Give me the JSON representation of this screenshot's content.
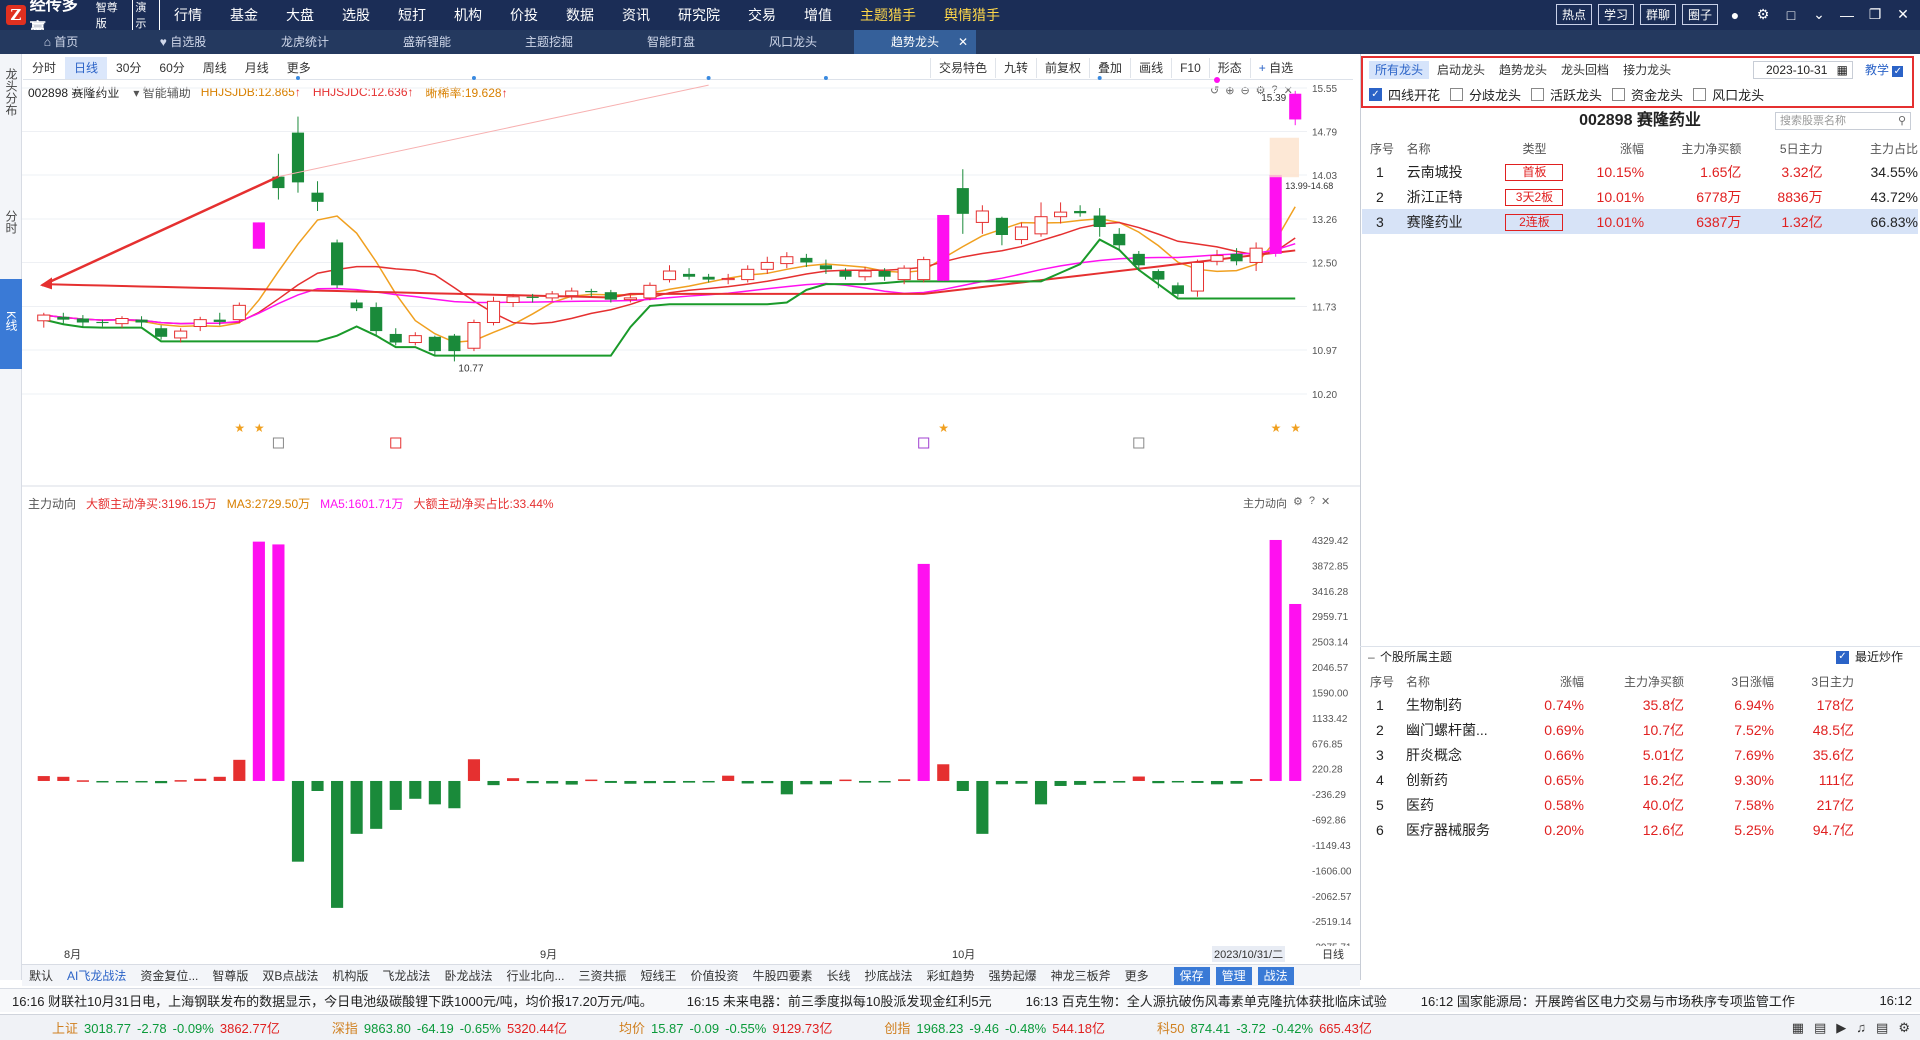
{
  "app": {
    "name": "经传多赢",
    "edition": "智尊版",
    "demo": "演示",
    "logo_letter": "Z"
  },
  "main_menu": [
    "行情",
    "基金",
    "大盘",
    "选股",
    "短打",
    "机构",
    "价投",
    "数据",
    "资讯",
    "研究院",
    "交易",
    "增值",
    "主题猎手",
    "舆情猎手"
  ],
  "top_right": {
    "buttons": [
      "热点",
      "学习",
      "群聊",
      "圈子"
    ],
    "icons": [
      "user-icon",
      "settings-icon",
      "window-icon",
      "chevron-down-icon",
      "minimize-icon",
      "restore-icon",
      "close-icon"
    ]
  },
  "tabs": [
    "首页",
    "自选股",
    "龙虎统计",
    "盛新锂能",
    "主题挖掘",
    "智能盯盘",
    "风口龙头",
    "趋势龙头"
  ],
  "left_rail": {
    "top": "龙头分布",
    "mid": "分时",
    "kline": "K线"
  },
  "periods": [
    "分时",
    "日线",
    "30分",
    "60分",
    "周线",
    "月线",
    "更多"
  ],
  "tools": [
    "交易特色",
    "九转",
    "前复权",
    "叠加",
    "画线",
    "F10",
    "形态",
    "自选"
  ],
  "stock": {
    "code_name": "002898 赛隆药业",
    "assist": "智能辅助",
    "ind1": "HHJSJDB:12.865",
    "ind2": "HHJSJDC:12.636",
    "ind3": "晰稀率:19.628",
    "price_high_label": "15.39",
    "range_label": "13.99-14.68",
    "low_label": "10.77",
    "y_ticks": [
      "15.55",
      "14.79",
      "14.03",
      "13.26",
      "12.50",
      "11.73",
      "10.97",
      "10.20"
    ]
  },
  "colors": {
    "up": "#e53030",
    "down": "#1a8a3a",
    "limit": "#ff10f0",
    "accent": "#2b63c7",
    "nav": "#1b2d56"
  },
  "sub_chart": {
    "title": "主力动向",
    "l1": "大额主动净买:3196.15万",
    "l2": "MA3:2729.50万",
    "l3": "MA5:1601.71万",
    "l4": "大额主动净买占比:33.44%",
    "unit": "X万",
    "y_ticks": [
      "4329.42",
      "3872.85",
      "3416.28",
      "2959.71",
      "2503.14",
      "2046.57",
      "1590.00",
      "1133.42",
      "676.85",
      "220.28",
      "-236.29",
      "-692.86",
      "-1149.43",
      "-1606.00",
      "-2062.57",
      "-2519.14",
      "-2975.71"
    ]
  },
  "chart_data": {
    "type": "candlestick",
    "title": "002898 赛隆药业",
    "ylim": [
      10.2,
      15.55
    ],
    "x_labels": [
      "8月",
      "9月",
      "10月",
      "2023/10/31/二"
    ],
    "candles": [
      [
        11.48,
        11.58,
        11.36,
        11.62,
        "u"
      ],
      [
        11.55,
        11.5,
        11.42,
        11.62,
        "d"
      ],
      [
        11.52,
        11.45,
        11.38,
        11.58,
        "d"
      ],
      [
        11.46,
        11.44,
        11.38,
        11.5,
        "d"
      ],
      [
        11.43,
        11.52,
        11.36,
        11.56,
        "u"
      ],
      [
        11.5,
        11.45,
        11.38,
        11.56,
        "d"
      ],
      [
        11.35,
        11.2,
        11.15,
        11.4,
        "d"
      ],
      [
        11.18,
        11.3,
        11.1,
        11.35,
        "u"
      ],
      [
        11.38,
        11.5,
        11.3,
        11.55,
        "u"
      ],
      [
        11.5,
        11.46,
        11.4,
        11.62,
        "d"
      ],
      [
        11.5,
        11.75,
        11.44,
        11.8,
        "u"
      ],
      [
        12.74,
        13.2,
        12.74,
        13.2,
        "l"
      ],
      [
        14.0,
        13.8,
        13.6,
        14.4,
        "d"
      ],
      [
        14.77,
        13.9,
        13.72,
        15.05,
        "d"
      ],
      [
        13.72,
        13.56,
        13.4,
        13.92,
        "d"
      ],
      [
        12.85,
        12.1,
        12.05,
        12.9,
        "d"
      ],
      [
        11.8,
        11.7,
        11.65,
        11.85,
        "d"
      ],
      [
        11.72,
        11.3,
        11.22,
        11.8,
        "d"
      ],
      [
        11.25,
        11.1,
        11.05,
        11.35,
        "d"
      ],
      [
        11.1,
        11.22,
        11.05,
        11.28,
        "u"
      ],
      [
        11.2,
        10.95,
        10.88,
        11.22,
        "d"
      ],
      [
        11.22,
        10.95,
        10.77,
        11.25,
        "d"
      ],
      [
        11.0,
        11.45,
        10.95,
        11.5,
        "u"
      ],
      [
        11.45,
        11.82,
        11.4,
        11.9,
        "u"
      ],
      [
        11.8,
        11.9,
        11.72,
        11.95,
        "u"
      ],
      [
        11.9,
        11.88,
        11.8,
        11.95,
        "d"
      ],
      [
        11.88,
        11.95,
        11.82,
        12.0,
        "u"
      ],
      [
        11.92,
        12.0,
        11.85,
        12.06,
        "u"
      ],
      [
        12.0,
        11.98,
        11.9,
        12.04,
        "d"
      ],
      [
        11.98,
        11.85,
        11.8,
        12.02,
        "d"
      ],
      [
        11.85,
        11.88,
        11.8,
        11.95,
        "u"
      ],
      [
        11.88,
        12.1,
        11.84,
        12.15,
        "u"
      ],
      [
        12.2,
        12.35,
        12.15,
        12.45,
        "u"
      ],
      [
        12.3,
        12.25,
        12.2,
        12.4,
        "d"
      ],
      [
        12.25,
        12.2,
        12.15,
        12.3,
        "d"
      ],
      [
        12.2,
        12.22,
        12.12,
        12.3,
        "u"
      ],
      [
        12.2,
        12.38,
        12.15,
        12.45,
        "u"
      ],
      [
        12.38,
        12.5,
        12.3,
        12.6,
        "u"
      ],
      [
        12.48,
        12.6,
        12.4,
        12.68,
        "u"
      ],
      [
        12.58,
        12.5,
        12.42,
        12.65,
        "d"
      ],
      [
        12.45,
        12.38,
        12.3,
        12.55,
        "d"
      ],
      [
        12.35,
        12.25,
        12.2,
        12.4,
        "d"
      ],
      [
        12.25,
        12.35,
        12.18,
        12.42,
        "u"
      ],
      [
        12.35,
        12.25,
        12.18,
        12.4,
        "d"
      ],
      [
        12.2,
        12.4,
        12.12,
        12.45,
        "u"
      ],
      [
        12.2,
        12.55,
        12.15,
        12.6,
        "u"
      ],
      [
        12.18,
        13.33,
        12.18,
        13.33,
        "l"
      ],
      [
        13.8,
        13.35,
        13.0,
        14.13,
        "d"
      ],
      [
        13.4,
        13.2,
        13.0,
        13.5,
        "u"
      ],
      [
        13.28,
        12.98,
        12.8,
        13.3,
        "d"
      ],
      [
        12.9,
        13.12,
        12.82,
        13.2,
        "u"
      ],
      [
        13.0,
        13.3,
        12.95,
        13.55,
        "u"
      ],
      [
        13.3,
        13.38,
        13.18,
        13.55,
        "u"
      ],
      [
        13.36,
        13.4,
        13.3,
        13.5,
        "d"
      ],
      [
        13.32,
        13.12,
        12.95,
        13.45,
        "d"
      ],
      [
        13.0,
        12.8,
        12.7,
        13.1,
        "d"
      ],
      [
        12.65,
        12.45,
        12.35,
        12.7,
        "d"
      ],
      [
        12.35,
        12.2,
        12.05,
        12.38,
        "d"
      ],
      [
        12.1,
        11.95,
        11.9,
        12.15,
        "d"
      ],
      [
        12.0,
        12.5,
        11.9,
        12.55,
        "u"
      ],
      [
        12.52,
        12.62,
        12.45,
        12.72,
        "u"
      ],
      [
        12.65,
        12.52,
        12.45,
        12.75,
        "d"
      ],
      [
        12.5,
        12.75,
        12.35,
        12.85,
        "u"
      ],
      [
        12.65,
        14.03,
        12.6,
        14.03,
        "l"
      ],
      [
        15.0,
        15.45,
        14.9,
        15.5,
        "l"
      ]
    ],
    "limit_zone": [
      13.99,
      14.68
    ],
    "sub_values": [
      88,
      75,
      12,
      -20,
      -15,
      -25,
      -40,
      15,
      40,
      75,
      380,
      4300,
      4250,
      -1450,
      -180,
      -2280,
      -950,
      -860,
      -520,
      -320,
      -420,
      -490,
      390,
      -75,
      50,
      -40,
      -45,
      -65,
      25,
      -35,
      -50,
      -40,
      -35,
      -30,
      -25,
      95,
      -45,
      -40,
      -240,
      -60,
      -60,
      25,
      -30,
      -25,
      30,
      3900,
      300,
      -180,
      -950,
      -60,
      -50,
      -420,
      -90,
      -70,
      -40,
      -30,
      80,
      -40,
      -25,
      -35,
      -60,
      -50,
      35,
      4330,
      3180
    ]
  },
  "dragon_panel": {
    "tabs": [
      "所有龙头",
      "启动龙头",
      "趋势龙头",
      "龙头回档",
      "接力龙头"
    ],
    "date": "2023-10-31",
    "teach": "教学",
    "checks": [
      {
        "label": "四线开花",
        "on": true
      },
      {
        "label": "分歧龙头",
        "on": false
      },
      {
        "label": "活跃龙头",
        "on": false
      },
      {
        "label": "资金龙头",
        "on": false
      },
      {
        "label": "风口龙头",
        "on": false
      }
    ],
    "stock_header": "002898  赛隆药业",
    "search_placeholder": "搜索股票名称",
    "headers": [
      "序号",
      "名称",
      "类型",
      "涨幅",
      "主力净买额",
      "5日主力",
      "主力占比"
    ],
    "rows": [
      {
        "no": "1",
        "name": "云南城投",
        "type": "首板",
        "chg": "10.15%",
        "net": "1.65亿",
        "d5": "3.32亿",
        "pct": "34.55%"
      },
      {
        "no": "2",
        "name": "浙江正特",
        "type": "3天2板",
        "chg": "10.01%",
        "net": "6778万",
        "d5": "8836万",
        "pct": "43.72%"
      },
      {
        "no": "3",
        "name": "赛隆药业",
        "type": "2连板",
        "chg": "10.01%",
        "net": "6387万",
        "d5": "1.32亿",
        "pct": "66.83%"
      }
    ]
  },
  "theme_panel": {
    "title": "个股所属主题",
    "recent": "最近炒作",
    "headers": [
      "序号",
      "名称",
      "涨幅",
      "主力净买额",
      "3日涨幅",
      "3日主力"
    ],
    "rows": [
      {
        "no": "1",
        "name": "生物制药",
        "chg": "0.74%",
        "net": "35.8亿",
        "c3": "6.94%",
        "m3": "178亿"
      },
      {
        "no": "2",
        "name": "幽门螺杆菌...",
        "chg": "0.69%",
        "net": "10.7亿",
        "c3": "7.52%",
        "m3": "48.5亿"
      },
      {
        "no": "3",
        "name": "肝炎概念",
        "chg": "0.66%",
        "net": "5.01亿",
        "c3": "7.69%",
        "m3": "35.6亿"
      },
      {
        "no": "4",
        "name": "创新药",
        "chg": "0.65%",
        "net": "16.2亿",
        "c3": "9.30%",
        "m3": "111亿"
      },
      {
        "no": "5",
        "name": "医药",
        "chg": "0.58%",
        "net": "40.0亿",
        "c3": "7.58%",
        "m3": "217亿"
      },
      {
        "no": "6",
        "name": "医疗器械服务",
        "chg": "0.20%",
        "net": "12.6亿",
        "c3": "5.25%",
        "m3": "94.7亿"
      }
    ]
  },
  "date_axis": {
    "m8": "8月",
    "m9": "9月",
    "m10": "10月",
    "cur": "2023/10/31/二",
    "period": "日线"
  },
  "strategies": [
    "默认",
    "AI飞龙战法",
    "资金复位...",
    "智尊版",
    "双B点战法",
    "机构版",
    "飞龙战法",
    "卧龙战法",
    "行业北向...",
    "三资共振",
    "短线王",
    "价值投资",
    "牛股四要素",
    "长线",
    "抄底战法",
    "彩虹趋势",
    "强势起爆",
    "神龙三板斧",
    "更多"
  ],
  "strategy_right": [
    "保存",
    "管理",
    "战法"
  ],
  "news": [
    "16:16 财联社10月31日电，上海钢联发布的数据显示，今日电池级碳酸锂下跌1000元/吨，均价报17.20万元/吨。",
    "16:15 未来电器：前三季度拟每10股派发现金红利5元",
    "16:13 百克生物：全人源抗破伤风毒素单克隆抗体获批临床试验",
    "16:12 国家能源局：开展跨省区电力交易与市场秩序专项监管工作"
  ],
  "news_time": "16:12",
  "indices": [
    {
      "name": "上证",
      "val": "3018.77",
      "chg": "-2.78",
      "pct": "-0.09%",
      "amt": "3862.77亿"
    },
    {
      "name": "深指",
      "val": "9863.80",
      "chg": "-64.19",
      "pct": "-0.65%",
      "amt": "5320.44亿"
    },
    {
      "name": "均价",
      "val": "15.87",
      "chg": "-0.09",
      "pct": "-0.55%",
      "amt": "9129.73亿"
    },
    {
      "name": "创指",
      "val": "1968.23",
      "chg": "-9.46",
      "pct": "-0.48%",
      "amt": "544.18亿"
    },
    {
      "name": "科50",
      "val": "874.41",
      "chg": "-3.72",
      "pct": "-0.42%",
      "amt": "665.43亿"
    }
  ]
}
